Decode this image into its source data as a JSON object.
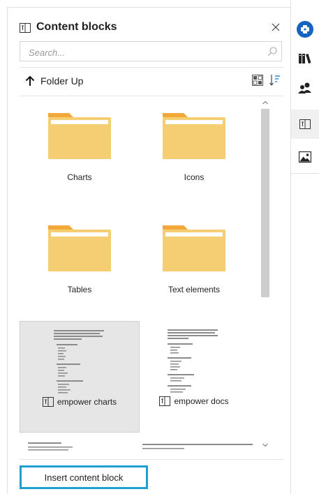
{
  "panel": {
    "title": "Content blocks",
    "search_placeholder": "Search...",
    "folder_up_label": "Folder Up",
    "insert_button_label": "Insert content block"
  },
  "folders": [
    {
      "label": "Charts"
    },
    {
      "label": "Icons"
    },
    {
      "label": "Tables"
    },
    {
      "label": "Text elements"
    }
  ],
  "documents": [
    {
      "label": "empower charts",
      "selected": true
    },
    {
      "label": "empower docs",
      "selected": false
    }
  ],
  "toolbar": {
    "items": [
      {
        "icon": "add-circle-icon",
        "active": false
      },
      {
        "icon": "library-icon",
        "active": false
      },
      {
        "icon": "people-icon",
        "active": false
      },
      {
        "icon": "content-blocks-icon",
        "active": true
      },
      {
        "icon": "picture-icon",
        "active": false
      }
    ]
  },
  "colors": {
    "folder": "#f5cd72",
    "folder_tab": "#f4a83a",
    "accent_blue": "#1e9fd2",
    "toolbar_blue": "#1565c0",
    "selected_bg": "#e6e6e6"
  }
}
